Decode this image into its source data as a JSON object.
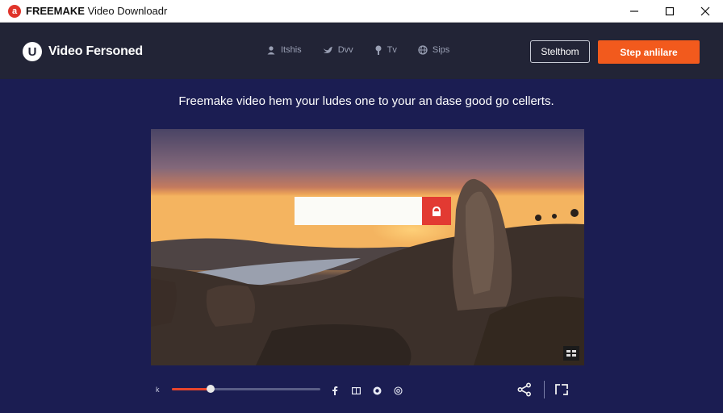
{
  "window": {
    "title_brand": "FREEMAKE",
    "title_rest": " Video Downloadr",
    "app_icon_glyph": "a"
  },
  "header": {
    "logo_glyph": "U",
    "logo_text": "Video Fersoned",
    "nav": [
      {
        "icon": "person-icon",
        "label": "Itshis"
      },
      {
        "icon": "bird-icon",
        "label": "Dvv"
      },
      {
        "icon": "pin-icon",
        "label": "Tv"
      },
      {
        "icon": "globe-icon",
        "label": "Sips"
      }
    ],
    "outline_button": "Stelthom",
    "primary_button": "Step anlilare"
  },
  "main": {
    "subtitle": "Freemake video hem your ludes one to your an dase good go cellerts.",
    "search": {
      "value": "",
      "placeholder": ""
    }
  },
  "player": {
    "progress": 0.26,
    "small_left_label": "k"
  },
  "colors": {
    "background": "#1b1d52",
    "header": "#222436",
    "accent": "#f25a1d",
    "search_button": "#e23a32",
    "progress": "#e8452c"
  }
}
